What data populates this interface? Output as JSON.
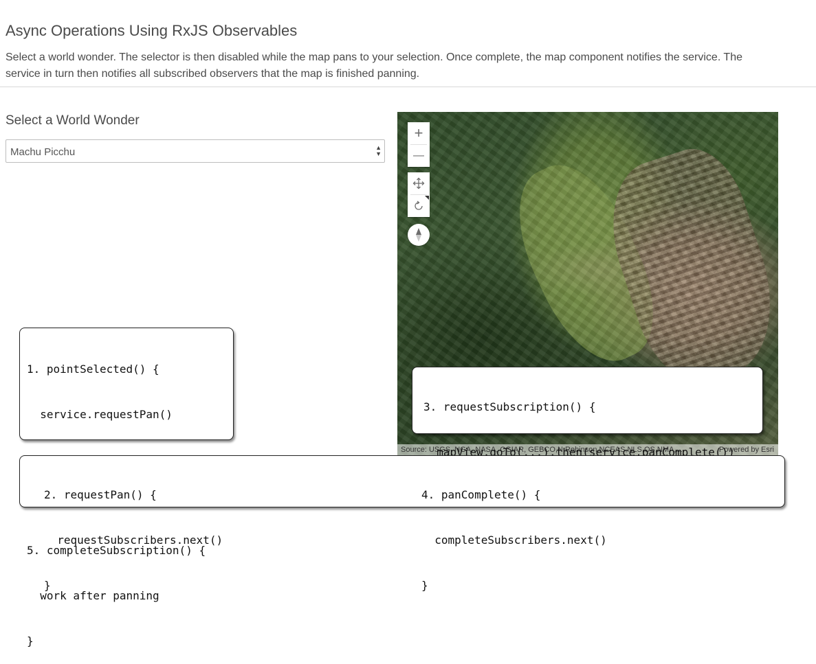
{
  "header": {
    "title": "Async Operations Using RxJS Observables",
    "description": "Select a world wonder. The selector is then disabled while the map pans to your selection. Once complete, the map component notifies the service. The service in turn then notifies all subscribed observers that the map is finished panning."
  },
  "selector": {
    "label": "Select a World Wonder",
    "selected_value": "Machu Picchu"
  },
  "map": {
    "controls": {
      "zoom_in": "+",
      "zoom_out": "—",
      "pan_icon": "pan-icon",
      "rotate_icon": "rotate-icon",
      "compass_icon": "compass-icon"
    },
    "attribution": {
      "source": "Source: USGS, NGA, NASA, CGIAR, GEBCO,N Robinson,NCEAS,NLS,OS,NMA,...",
      "powered_by": "Powered by Esri"
    }
  },
  "code": {
    "box1": {
      "lines": [
        "1. pointSelected() {",
        "  service.requestPan()",
        "}",
        "",
        "5. completeSubscription() {",
        "  work after panning",
        "}"
      ]
    },
    "box3": {
      "lines": [
        "3. requestSubscription() {",
        "  mapView.goTo(...).then(service.panComplete())",
        "}"
      ]
    },
    "box2": {
      "lines": [
        "2. requestPan() {",
        "  requestSubscribers.next()",
        "}"
      ]
    },
    "box4": {
      "lines": [
        "4. panComplete() {",
        "  completeSubscribers.next()",
        "}"
      ]
    }
  }
}
